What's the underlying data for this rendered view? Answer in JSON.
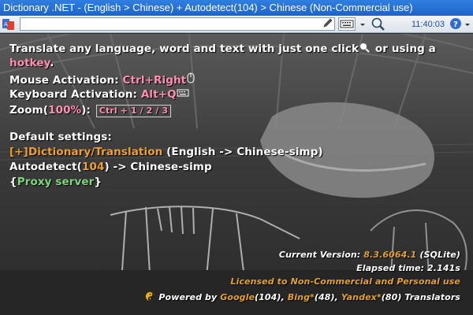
{
  "titlebar": {
    "title": "Dictionary .NET - (English > Chinese) + Autodetect(104) > Chinese (Non-Commercial use)"
  },
  "toolbar": {
    "search_value": "",
    "clock": "11:40:03"
  },
  "intro": {
    "line1": "Translate any language, word and text with just one click",
    "or_using": "or using a",
    "hotkey": "hotkey",
    "period": "."
  },
  "mouse": {
    "label": "Mouse Activation:",
    "value": "Ctrl+Right"
  },
  "keyboard": {
    "label": "Keyboard Activation:",
    "value": "Alt+Q"
  },
  "zoom": {
    "label": "Zoom(",
    "value": "100%",
    "close": "):",
    "keys": "Ctrl + 1 / 2 / 3"
  },
  "defaults": {
    "heading": "Default settings:",
    "dict_link": "[+]Dictionary/Translation",
    "dict_pair": "(English -> Chinese-simp)",
    "autodetect_prefix": "Autodetect(",
    "autodetect_count": "104",
    "autodetect_suffix": ") -> Chinese-simp",
    "proxy_open": "{",
    "proxy_link": "Proxy server",
    "proxy_close": "}"
  },
  "footer": {
    "version_label": "Current Version:",
    "version": "8.3.6064.1",
    "version_db": "(SQLite)",
    "elapsed": "Elapsed time: 2.141s",
    "license": "Licensed to Non-Commercial and Personal use",
    "powered_by": "Powered by",
    "google": "Google",
    "google_count": "(104),",
    "bing": "Bing*",
    "bing_count": "(48),",
    "yandex": "Yandex*",
    "yandex_count": "(80)",
    "translators": "Translators"
  },
  "icons": {
    "app": "dictionary-app-icon",
    "pencil": "pencil-icon",
    "keyboard": "keyboard-icon",
    "magnifier": "magnifier-icon",
    "help": "help-icon",
    "mouse": "mouse-icon",
    "yinyang": "yinyang-icon"
  },
  "colors": {
    "title_bar": "#1f63c8",
    "accent_pink": "#ff8fb0",
    "accent_orange": "#f0a030",
    "accent_green": "#7cd67c",
    "footer_gold": "#e2a22c"
  }
}
